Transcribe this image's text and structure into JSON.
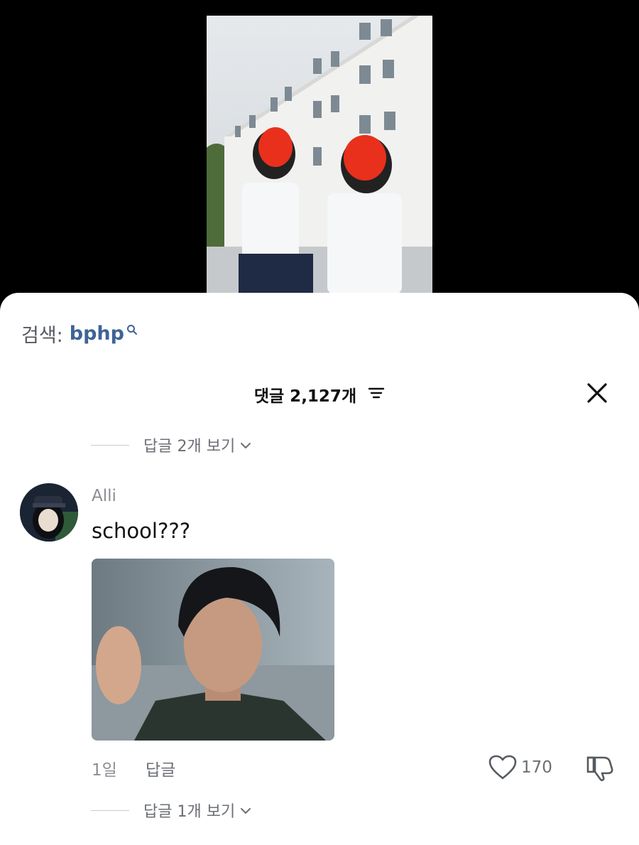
{
  "search": {
    "prefix": "검색:",
    "term": "bphp"
  },
  "header": {
    "count_label": "댓글 2,127개"
  },
  "replies_top": {
    "label": "답글 2개 보기"
  },
  "comment": {
    "username": "Alli",
    "text": "school???",
    "time": "1일",
    "reply_label": "답글",
    "likes": "170"
  },
  "replies_bottom": {
    "label": "답글 1개 보기"
  }
}
